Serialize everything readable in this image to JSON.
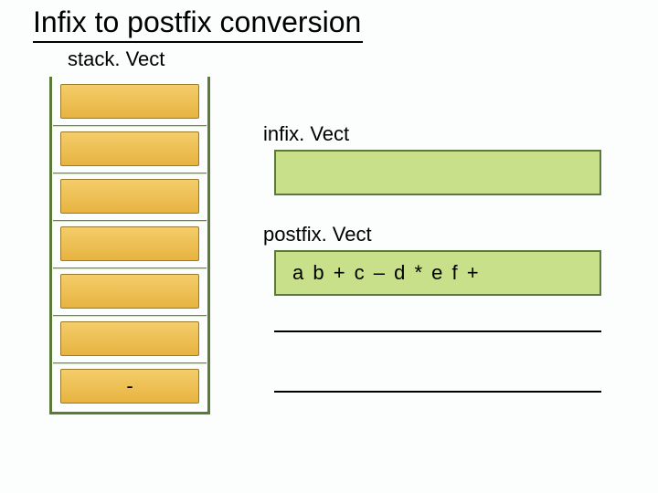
{
  "title": "Infix to postfix conversion",
  "stack": {
    "label": "stack. Vect",
    "cells": [
      "",
      "",
      "",
      "",
      "",
      "",
      "-"
    ]
  },
  "infix": {
    "label": "infix. Vect",
    "value": ""
  },
  "postfix": {
    "label": "postfix. Vect",
    "value": "a b + c – d * e f +"
  }
}
